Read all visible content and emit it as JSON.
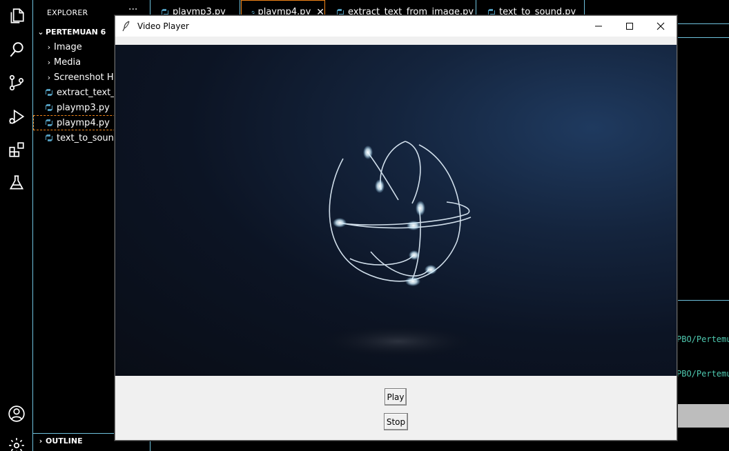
{
  "explorer": {
    "title": "EXPLORER",
    "more": "···",
    "workspace": "PERTEMUAN 6",
    "items": [
      {
        "label": "Image",
        "kind": "folder"
      },
      {
        "label": "Media",
        "kind": "folder"
      },
      {
        "label": "Screenshot Ha:",
        "kind": "folder"
      },
      {
        "label": "extract_text_fro",
        "kind": "file"
      },
      {
        "label": "playmp3.py",
        "kind": "file"
      },
      {
        "label": "playmp4.py",
        "kind": "file",
        "selected": true
      },
      {
        "label": "text_to_sound.p",
        "kind": "file"
      }
    ],
    "outline": "OUTLINE"
  },
  "tabs": [
    {
      "label": "playmp3.py"
    },
    {
      "label": "playmp4.py",
      "active": true
    },
    {
      "label": "extract_text_from_image.py"
    },
    {
      "label": "text_to_sound.py"
    }
  ],
  "terminal": {
    "line1": "PBO/Pertemu",
    "line2": "PBO/Pertemu"
  },
  "player": {
    "title": "Video Player",
    "play_label": "Play",
    "stop_label": "Stop",
    "minimize": "—",
    "maximize": "☐",
    "close": "✕"
  },
  "colors": {
    "contrast_border": "#6fc3df",
    "active_border": "#f38518",
    "terminal_text": "#4ec9b0",
    "python_icon": "#519aba"
  },
  "icons": [
    "files-icon",
    "search-icon",
    "source-control-icon",
    "run-debug-icon",
    "extensions-icon",
    "testing-icon",
    "account-icon",
    "settings-gear-icon",
    "python-file-icon",
    "feather-icon"
  ]
}
